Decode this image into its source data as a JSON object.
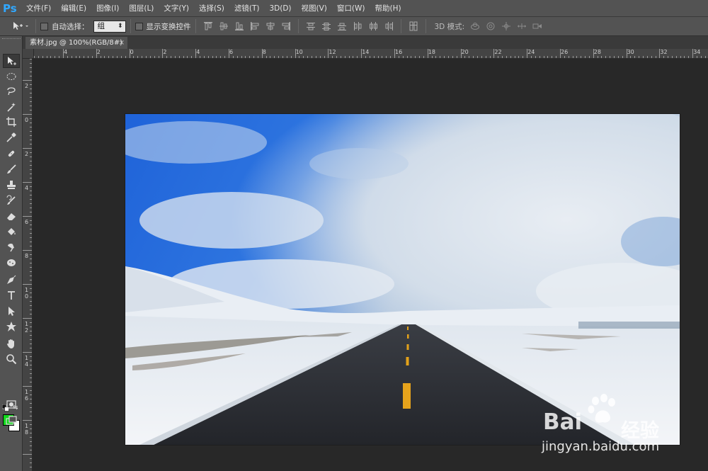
{
  "app": {
    "logo": "Ps"
  },
  "menu": [
    "文件(F)",
    "编辑(E)",
    "图像(I)",
    "图层(L)",
    "文字(Y)",
    "选择(S)",
    "滤镜(T)",
    "3D(D)",
    "视图(V)",
    "窗口(W)",
    "帮助(H)"
  ],
  "options": {
    "auto_select_label": "自动选择：",
    "auto_select_value": "组",
    "show_transform_label": "显示变换控件",
    "mode_3d_label": "3D 模式:"
  },
  "document": {
    "tab_title": "素材.jpg @ 100%(RGB/8#)",
    "close": "×"
  },
  "rulers": {
    "h": [
      "4",
      "2",
      "0",
      "2",
      "4",
      "6",
      "8",
      "10",
      "12",
      "14",
      "16",
      "18",
      "20",
      "22",
      "24",
      "26",
      "28",
      "30",
      "32",
      "34"
    ],
    "v": [
      "2",
      "0",
      "2",
      "4",
      "6",
      "8",
      "1 0",
      "1 2",
      "1 4",
      "1 6",
      "1 8"
    ]
  },
  "colors": {
    "foreground": "#12d91c",
    "background": "#ffffff"
  },
  "watermark": {
    "brand": "Bai",
    "brand_suffix": "经验",
    "url": "jingyan.baidu.com"
  }
}
